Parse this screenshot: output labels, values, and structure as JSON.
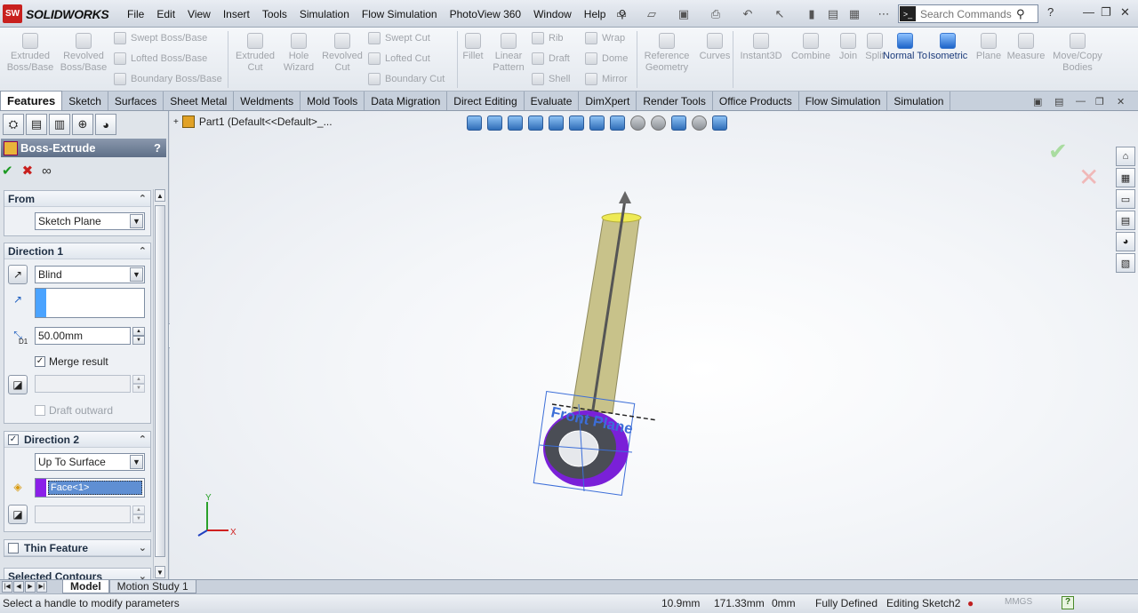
{
  "app": {
    "name": "SOLIDWORKS",
    "logo_text": "SW"
  },
  "menu": [
    "File",
    "Edit",
    "View",
    "Insert",
    "Tools",
    "Simulation",
    "Flow Simulation",
    "PhotoView 360",
    "Window",
    "Help"
  ],
  "search": {
    "placeholder": "Search Commands"
  },
  "commands": {
    "extruded_boss": "Extruded Boss/Base",
    "revolved_boss": "Revolved Boss/Base",
    "swept_boss": "Swept Boss/Base",
    "lofted_boss": "Lofted Boss/Base",
    "boundary_boss": "Boundary Boss/Base",
    "extruded_cut": "Extruded Cut",
    "hole_wizard": "Hole Wizard",
    "revolved_cut": "Revolved Cut",
    "swept_cut": "Swept Cut",
    "lofted_cut": "Lofted Cut",
    "boundary_cut": "Boundary Cut",
    "fillet": "Fillet",
    "linear_pattern": "Linear Pattern",
    "rib": "Rib",
    "draft": "Draft",
    "shell": "Shell",
    "wrap": "Wrap",
    "dome": "Dome",
    "mirror": "Mirror",
    "reference_geometry": "Reference Geometry",
    "curves": "Curves",
    "instant3d": "Instant3D",
    "combine": "Combine",
    "join": "Join",
    "split": "Split",
    "normal_to": "Normal To",
    "isometric": "Isometric",
    "plane": "Plane",
    "measure": "Measure",
    "move_copy": "Move/Copy Bodies"
  },
  "tabs": [
    "Features",
    "Sketch",
    "Surfaces",
    "Sheet Metal",
    "Weldments",
    "Mold Tools",
    "Data Migration",
    "Direct Editing",
    "Evaluate",
    "DimXpert",
    "Render Tools",
    "Office Products",
    "Flow Simulation",
    "Simulation"
  ],
  "active_tab": "Features",
  "property_manager": {
    "title": "Boss-Extrude",
    "help": "?",
    "from": {
      "header": "From",
      "value": "Sketch Plane"
    },
    "direction1": {
      "header": "Direction 1",
      "end_condition": "Blind",
      "depth": "50.00mm",
      "merge_result": "Merge result",
      "draft_outward": "Draft outward",
      "depth_label": "D1"
    },
    "direction2": {
      "header": "Direction 2",
      "end_condition": "Up To Surface",
      "face": "Face<1>"
    },
    "thin_feature": {
      "header": "Thin Feature"
    },
    "selected_contours": {
      "header": "Selected Contours"
    }
  },
  "tree": {
    "part": "Part1  (Default<<Default>_..."
  },
  "viewport": {
    "plane_label": "Front Plane",
    "triad": {
      "x": "X",
      "y": "Y"
    }
  },
  "bottom_tabs": [
    "Model",
    "Motion Study 1"
  ],
  "status": {
    "message": "Select a handle to modify parameters",
    "x": "10.9mm",
    "y": "171.33mm",
    "z": "0mm",
    "state": "Fully Defined",
    "mode": "Editing Sketch2",
    "units": "MMGS",
    "help": "?"
  },
  "colors": {
    "accent": "#1c64c8",
    "face_chip": "#8b1fe8",
    "direction_chip": "#4aa3ff",
    "cylinder": "#c8c28a",
    "ring": "#7a20d8"
  }
}
